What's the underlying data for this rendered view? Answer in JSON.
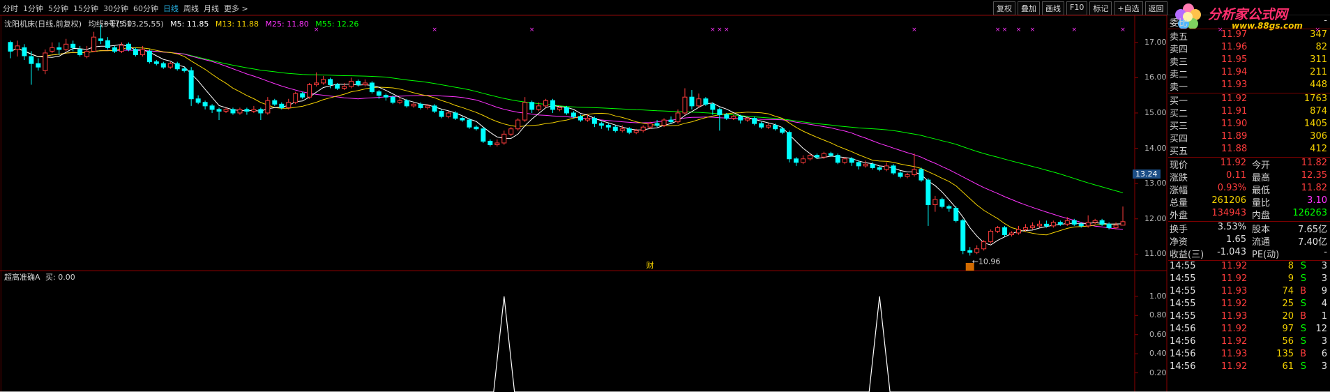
{
  "periods": [
    {
      "label": "分时",
      "active": false
    },
    {
      "label": "1分钟",
      "active": false
    },
    {
      "label": "5分钟",
      "active": false
    },
    {
      "label": "15分钟",
      "active": false
    },
    {
      "label": "30分钟",
      "active": false
    },
    {
      "label": "60分钟",
      "active": false
    },
    {
      "label": "日线",
      "active": true
    },
    {
      "label": "周线",
      "active": false
    },
    {
      "label": "月线",
      "active": false
    },
    {
      "label": "更多 >",
      "active": false
    }
  ],
  "toolbar": [
    "复权",
    "叠加",
    "画线",
    "F10",
    "标记",
    "+自选",
    "返回"
  ],
  "logo": {
    "title": "分析家公式网",
    "url": "www.88gs.com"
  },
  "stock": {
    "title": "沈阳机床(日线,前复权)",
    "ma_name": "均线3号(5,13,25,55)",
    "ma5": "M5: 11.85",
    "ma13": "M13: 11.88",
    "ma25": "M25: 11.80",
    "ma55": "M55: 12.26"
  },
  "indicator": {
    "title": "超高准确A",
    "value": "买: 0.00"
  },
  "markers": {
    "cai": "财",
    "high_label": "17.50",
    "low_label": "10.96",
    "current_price": "13.24"
  },
  "colors": {
    "up": "#ff3c3c",
    "down": "#00ffff",
    "ma5": "#ffffff",
    "ma13": "#f3d000",
    "ma25": "#ff33ff",
    "ma55": "#00ff00",
    "frame": "#8b0000",
    "bg": "#000000"
  },
  "price_axis": [
    "17.00",
    "16.00",
    "15.00",
    "14.00",
    "13.00",
    "12.00",
    "11.00"
  ],
  "indicator_axis": [
    "1.00",
    "0.80",
    "0.60",
    "0.40",
    "0.20"
  ],
  "order_book": {
    "ratio": {
      "label": "委比",
      "value": "-"
    },
    "sell": [
      {
        "label": "卖五",
        "price": "11.97",
        "vol": "347"
      },
      {
        "label": "卖四",
        "price": "11.96",
        "vol": "82"
      },
      {
        "label": "卖三",
        "price": "11.95",
        "vol": "311"
      },
      {
        "label": "卖二",
        "price": "11.94",
        "vol": "211"
      },
      {
        "label": "卖一",
        "price": "11.93",
        "vol": "448"
      }
    ],
    "buy": [
      {
        "label": "买一",
        "price": "11.92",
        "vol": "1763"
      },
      {
        "label": "买二",
        "price": "11.91",
        "vol": "874"
      },
      {
        "label": "买三",
        "price": "11.90",
        "vol": "1405"
      },
      {
        "label": "买四",
        "price": "11.89",
        "vol": "306"
      },
      {
        "label": "买五",
        "price": "11.88",
        "vol": "412"
      }
    ]
  },
  "quote": [
    {
      "l1": "现价",
      "v1": "11.92",
      "c1": "#ff3c3c",
      "l2": "今开",
      "v2": "11.82",
      "c2": "#ff3c3c"
    },
    {
      "l1": "涨跌",
      "v1": "0.11",
      "c1": "#ff3c3c",
      "l2": "最高",
      "v2": "12.35",
      "c2": "#ff3c3c"
    },
    {
      "l1": "涨幅",
      "v1": "0.93%",
      "c1": "#ff3c3c",
      "l2": "最低",
      "v2": "11.82",
      "c2": "#ff3c3c"
    },
    {
      "l1": "总量",
      "v1": "261206",
      "c1": "#f3d000",
      "l2": "量比",
      "v2": "3.10",
      "c2": "#ff33ff"
    },
    {
      "l1": "外盘",
      "v1": "134943",
      "c1": "#ff3c3c",
      "l2": "内盘",
      "v2": "126263",
      "c2": "#00ff00"
    }
  ],
  "stats": [
    {
      "l1": "换手",
      "v1": "3.53%",
      "l2": "股本",
      "v2": "7.65亿"
    },
    {
      "l1": "净资",
      "v1": "1.65",
      "l2": "流通",
      "v2": "7.40亿"
    },
    {
      "l1": "收益(三)",
      "v1": "-1.043",
      "l2": "PE(动)",
      "v2": "-"
    }
  ],
  "ticks": [
    {
      "time": "14:55",
      "price": "11.92",
      "vol": "8",
      "side": "S",
      "num": "3"
    },
    {
      "time": "14:55",
      "price": "11.92",
      "vol": "9",
      "side": "S",
      "num": "3"
    },
    {
      "time": "14:55",
      "price": "11.93",
      "vol": "74",
      "side": "B",
      "num": "9"
    },
    {
      "time": "14:55",
      "price": "11.92",
      "vol": "25",
      "side": "S",
      "num": "4"
    },
    {
      "time": "14:55",
      "price": "11.93",
      "vol": "20",
      "side": "B",
      "num": "1"
    },
    {
      "time": "14:56",
      "price": "11.92",
      "vol": "97",
      "side": "S",
      "num": "12"
    },
    {
      "time": "14:56",
      "price": "11.92",
      "vol": "56",
      "side": "S",
      "num": "3"
    },
    {
      "time": "14:56",
      "price": "11.93",
      "vol": "135",
      "side": "B",
      "num": "6"
    },
    {
      "time": "14:56",
      "price": "11.92",
      "vol": "61",
      "side": "S",
      "num": "3"
    }
  ],
  "chart_data": {
    "type": "candlestick",
    "ylim": [
      10.75,
      17.45
    ],
    "indicator_ylim": [
      0,
      1.05
    ],
    "candles": [
      [
        17.0,
        16.75,
        17.05,
        16.55
      ],
      [
        16.8,
        16.9,
        17.05,
        16.6
      ],
      [
        16.85,
        16.62,
        16.95,
        16.5
      ],
      [
        16.6,
        16.4,
        16.75,
        15.8
      ],
      [
        16.4,
        16.3,
        16.55,
        16.2
      ],
      [
        16.2,
        16.7,
        16.8,
        16.1
      ],
      [
        16.75,
        16.85,
        17.0,
        16.7
      ],
      [
        16.85,
        16.8,
        17.0,
        16.65
      ],
      [
        16.8,
        16.95,
        17.1,
        16.75
      ],
      [
        16.95,
        16.85,
        17.05,
        16.75
      ],
      [
        16.8,
        16.65,
        16.9,
        16.6
      ],
      [
        16.6,
        16.75,
        16.9,
        16.55
      ],
      [
        16.75,
        17.15,
        17.3,
        16.75
      ],
      [
        17.1,
        17.05,
        17.5,
        16.95
      ],
      [
        17.05,
        16.85,
        17.15,
        16.8
      ],
      [
        16.85,
        16.75,
        16.9,
        16.7
      ],
      [
        16.75,
        16.92,
        17.0,
        16.7
      ],
      [
        16.95,
        16.8,
        17.0,
        16.75
      ],
      [
        16.8,
        16.65,
        16.85,
        16.6
      ],
      [
        16.65,
        16.8,
        16.9,
        16.6
      ],
      [
        16.75,
        16.45,
        16.8,
        16.4
      ],
      [
        16.45,
        16.4,
        16.5,
        16.35
      ],
      [
        16.4,
        16.3,
        16.45,
        16.25
      ],
      [
        16.3,
        16.4,
        16.45,
        16.25
      ],
      [
        16.4,
        16.25,
        16.45,
        16.2
      ],
      [
        16.25,
        16.2,
        16.3,
        16.15
      ],
      [
        16.2,
        15.4,
        16.3,
        15.2
      ],
      [
        15.4,
        15.3,
        15.5,
        15.25
      ],
      [
        15.3,
        15.2,
        15.35,
        15.1
      ],
      [
        15.2,
        15.1,
        15.25,
        15.0
      ],
      [
        15.1,
        15.05,
        15.15,
        14.8
      ],
      [
        15.05,
        15.1,
        15.15,
        15.0
      ],
      [
        15.1,
        15.0,
        15.15,
        14.95
      ],
      [
        15.0,
        15.1,
        15.15,
        14.95
      ],
      [
        15.1,
        15.05,
        15.15,
        14.95
      ],
      [
        15.05,
        15.1,
        15.2,
        15.0
      ],
      [
        15.1,
        15.0,
        15.15,
        14.8
      ],
      [
        15.0,
        15.35,
        15.45,
        14.95
      ],
      [
        15.35,
        15.25,
        15.4,
        15.2
      ],
      [
        15.25,
        15.15,
        15.3,
        15.1
      ],
      [
        15.15,
        15.3,
        15.4,
        15.1
      ],
      [
        15.3,
        15.55,
        15.6,
        15.25
      ],
      [
        15.55,
        15.45,
        15.6,
        15.4
      ],
      [
        15.45,
        15.8,
        15.85,
        15.4
      ],
      [
        15.8,
        15.85,
        16.15,
        15.75
      ],
      [
        15.85,
        15.95,
        16.05,
        15.8
      ],
      [
        15.95,
        15.8,
        16.0,
        15.7
      ],
      [
        15.8,
        15.7,
        15.85,
        15.65
      ],
      [
        15.7,
        15.75,
        15.85,
        15.65
      ],
      [
        15.75,
        15.9,
        16.0,
        15.7
      ],
      [
        15.9,
        15.8,
        15.95,
        15.75
      ],
      [
        15.8,
        15.85,
        15.95,
        15.75
      ],
      [
        15.85,
        15.6,
        15.9,
        15.55
      ],
      [
        15.6,
        15.5,
        15.65,
        15.4
      ],
      [
        15.5,
        15.45,
        15.55,
        15.35
      ],
      [
        15.45,
        15.3,
        15.5,
        15.25
      ],
      [
        15.3,
        15.35,
        15.45,
        15.25
      ],
      [
        15.35,
        15.2,
        15.4,
        15.15
      ],
      [
        15.2,
        15.25,
        15.3,
        15.15
      ],
      [
        15.25,
        15.15,
        15.3,
        15.1
      ],
      [
        15.15,
        15.2,
        15.25,
        15.1
      ],
      [
        15.2,
        15.05,
        15.25,
        15.0
      ],
      [
        15.05,
        14.9,
        15.1,
        14.85
      ],
      [
        14.9,
        15.0,
        15.05,
        14.85
      ],
      [
        15.0,
        14.85,
        15.05,
        14.8
      ],
      [
        14.85,
        14.8,
        14.9,
        14.75
      ],
      [
        14.8,
        14.6,
        14.85,
        14.55
      ],
      [
        14.6,
        14.55,
        14.65,
        14.5
      ],
      [
        14.55,
        14.2,
        14.6,
        14.15
      ],
      [
        14.2,
        14.1,
        14.25,
        14.05
      ],
      [
        14.1,
        14.15,
        14.25,
        14.05
      ],
      [
        14.15,
        14.4,
        14.5,
        14.1
      ],
      [
        14.4,
        14.55,
        14.6,
        14.35
      ],
      [
        14.55,
        14.8,
        14.85,
        14.5
      ],
      [
        14.8,
        15.3,
        15.45,
        14.75
      ],
      [
        15.3,
        15.1,
        15.35,
        15.0
      ],
      [
        15.1,
        15.2,
        15.3,
        15.05
      ],
      [
        15.2,
        15.35,
        15.4,
        15.15
      ],
      [
        15.35,
        15.1,
        15.4,
        15.0
      ],
      [
        15.1,
        15.15,
        15.2,
        15.05
      ],
      [
        15.15,
        15.0,
        15.2,
        14.95
      ],
      [
        15.0,
        14.9,
        15.05,
        14.85
      ],
      [
        14.9,
        14.8,
        14.95,
        14.75
      ],
      [
        14.8,
        14.85,
        14.95,
        14.75
      ],
      [
        14.85,
        14.7,
        14.9,
        14.6
      ],
      [
        14.7,
        14.65,
        14.75,
        14.55
      ],
      [
        14.65,
        14.6,
        14.7,
        14.5
      ],
      [
        14.6,
        14.5,
        14.65,
        14.45
      ],
      [
        14.5,
        14.55,
        14.65,
        14.45
      ],
      [
        14.55,
        14.45,
        14.6,
        14.4
      ],
      [
        14.45,
        14.5,
        14.55,
        14.4
      ],
      [
        14.5,
        14.6,
        14.65,
        14.45
      ],
      [
        14.6,
        14.7,
        14.75,
        14.55
      ],
      [
        14.7,
        14.65,
        14.8,
        14.6
      ],
      [
        14.65,
        14.8,
        14.85,
        14.6
      ],
      [
        14.8,
        14.75,
        14.9,
        14.7
      ],
      [
        14.75,
        15.0,
        15.1,
        14.7
      ],
      [
        15.0,
        15.45,
        15.7,
        14.95
      ],
      [
        15.45,
        15.2,
        15.65,
        15.1
      ],
      [
        15.2,
        15.4,
        15.55,
        15.15
      ],
      [
        15.4,
        15.25,
        15.45,
        15.2
      ],
      [
        15.25,
        15.1,
        15.3,
        14.95
      ],
      [
        15.1,
        14.95,
        15.15,
        14.5
      ],
      [
        14.95,
        14.85,
        15.0,
        14.8
      ],
      [
        14.85,
        14.9,
        14.95,
        14.8
      ],
      [
        14.9,
        14.8,
        14.95,
        14.7
      ],
      [
        14.8,
        14.85,
        14.9,
        14.75
      ],
      [
        14.85,
        14.7,
        14.9,
        14.65
      ],
      [
        14.7,
        14.6,
        14.75,
        14.55
      ],
      [
        14.6,
        14.65,
        14.7,
        14.55
      ],
      [
        14.65,
        14.55,
        14.7,
        14.5
      ],
      [
        14.55,
        14.45,
        14.6,
        14.4
      ],
      [
        14.45,
        13.7,
        14.5,
        13.6
      ],
      [
        13.7,
        13.6,
        13.75,
        13.5
      ],
      [
        13.6,
        13.7,
        13.8,
        13.55
      ],
      [
        13.7,
        13.8,
        13.85,
        13.65
      ],
      [
        13.8,
        13.75,
        13.85,
        13.7
      ],
      [
        13.75,
        13.85,
        13.9,
        13.7
      ],
      [
        13.85,
        13.8,
        13.9,
        13.75
      ],
      [
        13.8,
        13.6,
        13.85,
        13.55
      ],
      [
        13.6,
        13.7,
        13.75,
        13.55
      ],
      [
        13.7,
        13.6,
        13.75,
        13.5
      ],
      [
        13.6,
        13.5,
        13.65,
        13.4
      ],
      [
        13.5,
        13.55,
        13.65,
        13.45
      ],
      [
        13.55,
        13.45,
        13.6,
        13.4
      ],
      [
        13.45,
        13.4,
        13.5,
        13.35
      ],
      [
        13.4,
        13.5,
        13.6,
        13.35
      ],
      [
        13.5,
        13.3,
        13.55,
        13.25
      ],
      [
        13.3,
        13.2,
        13.35,
        13.15
      ],
      [
        13.2,
        13.25,
        13.3,
        13.15
      ],
      [
        13.25,
        13.4,
        13.85,
        13.2
      ],
      [
        13.4,
        13.1,
        13.45,
        13.05
      ],
      [
        13.1,
        12.4,
        13.15,
        11.8
      ],
      [
        12.4,
        12.55,
        12.65,
        12.2
      ],
      [
        12.55,
        12.35,
        12.6,
        12.3
      ],
      [
        12.35,
        12.3,
        12.4,
        12.2
      ],
      [
        12.3,
        11.95,
        12.35,
        11.9
      ],
      [
        11.95,
        11.1,
        12.0,
        11.0
      ],
      [
        11.1,
        11.05,
        11.2,
        10.96
      ],
      [
        11.05,
        11.15,
        11.25,
        11.0
      ],
      [
        11.15,
        11.35,
        11.4,
        11.1
      ],
      [
        11.35,
        11.65,
        11.7,
        11.3
      ],
      [
        11.65,
        11.75,
        11.8,
        11.6
      ],
      [
        11.75,
        11.55,
        11.8,
        11.5
      ],
      [
        11.55,
        11.6,
        11.65,
        11.5
      ],
      [
        11.6,
        11.7,
        11.8,
        11.55
      ],
      [
        11.7,
        11.75,
        11.85,
        11.65
      ],
      [
        11.75,
        11.8,
        11.9,
        11.7
      ],
      [
        11.8,
        11.85,
        11.95,
        11.75
      ],
      [
        11.85,
        11.8,
        11.95,
        11.75
      ],
      [
        11.8,
        11.9,
        11.95,
        11.75
      ],
      [
        11.9,
        11.85,
        11.95,
        11.8
      ],
      [
        11.85,
        11.95,
        12.05,
        11.8
      ],
      [
        11.95,
        11.85,
        12.0,
        11.8
      ],
      [
        11.85,
        11.8,
        11.9,
        11.75
      ],
      [
        11.8,
        11.9,
        12.1,
        11.75
      ],
      [
        11.9,
        11.95,
        12.0,
        11.85
      ],
      [
        11.95,
        11.85,
        12.0,
        11.8
      ],
      [
        11.85,
        11.75,
        11.9,
        11.7
      ],
      [
        11.75,
        11.82,
        11.9,
        11.7
      ],
      [
        11.82,
        11.92,
        12.35,
        11.82
      ]
    ],
    "signals": [
      71,
      125,
      197,
      246
    ],
    "cross_marks": [
      44,
      61,
      75,
      101,
      102,
      103,
      130,
      142,
      143,
      145,
      147,
      153,
      160,
      174,
      188,
      209,
      230,
      244,
      256,
      269,
      279,
      283
    ]
  }
}
